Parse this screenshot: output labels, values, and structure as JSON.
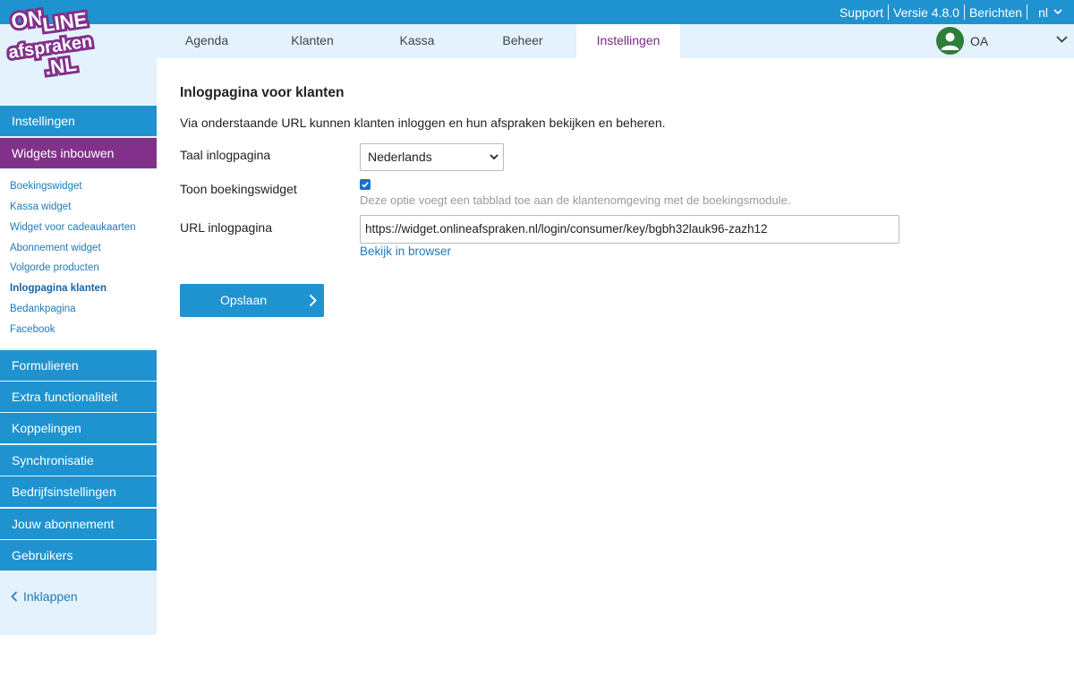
{
  "topbar": {
    "support": "Support",
    "version": "Versie 4.8.0",
    "messages": "Berichten",
    "language": "nl"
  },
  "logo": {
    "line1": "ON",
    "line2": "LINE",
    "line3": "afspraken",
    "line4": ".NL"
  },
  "nav": {
    "tabs": [
      "Agenda",
      "Klanten",
      "Kassa",
      "Beheer",
      "Instellingen"
    ],
    "active_tab": "Instellingen",
    "user_initials": "OA"
  },
  "sidebar": {
    "settings": "Instellingen",
    "widgets": "Widgets inbouwen",
    "sub_items": [
      "Boekingswidget",
      "Kassa widget",
      "Widget voor cadeaukaarten",
      "Abonnement widget",
      "Volgorde producten",
      "Inlogpagina klanten",
      "Bedankpagina",
      "Facebook"
    ],
    "current_sub": "Inlogpagina klanten",
    "sections": [
      "Formulieren",
      "Extra functionaliteit",
      "Koppelingen",
      "Synchronisatie",
      "Bedrijfsinstellingen",
      "Jouw abonnement",
      "Gebruikers"
    ],
    "collapse": "Inklappen"
  },
  "main": {
    "title": "Inlogpagina voor klanten",
    "intro": "Via onderstaande URL kunnen klanten inloggen en hun afspraken bekijken en beheren.",
    "language_label": "Taal inlogpagina",
    "language_value": "Nederlands",
    "widget_label": "Toon boekingswidget",
    "widget_checked": true,
    "widget_hint": "Deze optie voegt een tabblad toe aan de klantenomgeving met de boekingsmodule.",
    "url_label": "URL inlogpagina",
    "url_value": "https://widget.onlineafspraken.nl/login/consumer/key/bgbh32lauk96-zazh12",
    "view_link": "Bekijk in browser",
    "save_button": "Opslaan"
  },
  "colors": {
    "primary_blue": "#1f93cf",
    "brand_purple": "#82318a",
    "nav_bg": "#e3f2fc",
    "avatar_green": "#2e7d3a",
    "link_blue": "#1f7ab8"
  }
}
